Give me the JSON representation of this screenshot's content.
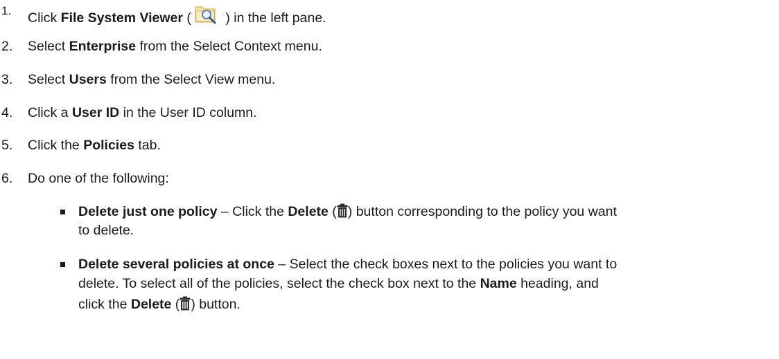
{
  "steps": [
    {
      "num": "1.",
      "pre": "Click ",
      "bold": "File System Viewer",
      "mid": " (",
      "icon": "folder-search-icon",
      "post": " ) in the left pane."
    },
    {
      "num": "2.",
      "pre": "Select ",
      "bold": "Enterprise",
      "post": " from the Select Context menu."
    },
    {
      "num": "3.",
      "pre": "Select ",
      "bold": "Users",
      "post": " from the Select View menu."
    },
    {
      "num": "4.",
      "pre": "Click a ",
      "bold": "User ID",
      "post": " in the User ID column."
    },
    {
      "num": "5.",
      "pre": "Click the ",
      "bold": "Policies",
      "post": " tab."
    },
    {
      "num": "6.",
      "text": "Do one of the following:"
    }
  ],
  "bullets": [
    {
      "bold": "Delete just one policy",
      "text1": " – Click the ",
      "bold2": "Delete",
      "text2_pre": " (",
      "icon": "trash-icon",
      "text2_post": ") button corresponding to the policy you want",
      "line2": "to delete."
    },
    {
      "bold": "Delete several policies at once",
      "text1": " – Select the check boxes next to the policies you want to",
      "line2_pre": "delete. To select all of the policies, select the check box next to the ",
      "line2_bold": "Name",
      "line2_post": " heading, and",
      "line3_pre": "click the ",
      "line3_bold": "Delete",
      "line3_mid": " (",
      "icon": "trash-icon",
      "line3_post": ") button."
    }
  ]
}
